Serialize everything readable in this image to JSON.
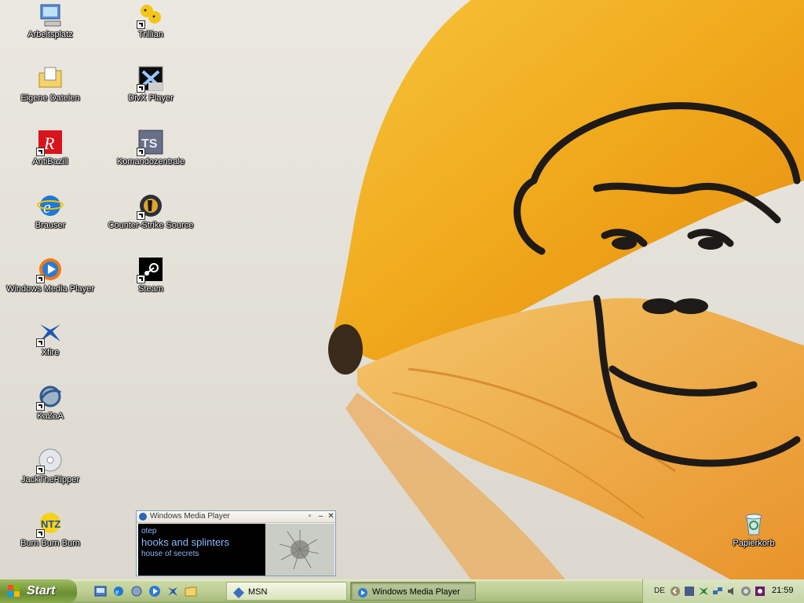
{
  "desktop": {
    "icons": [
      {
        "label": "Arbeitsplatz",
        "icon": "my-computer-icon"
      },
      {
        "label": "Eigene Dateien",
        "icon": "my-documents-icon"
      },
      {
        "label": "AntiBazill",
        "icon": "antivir-icon"
      },
      {
        "label": "Brauser",
        "icon": "internet-explorer-icon"
      },
      {
        "label": "Windows Media Player",
        "icon": "windows-media-player-icon"
      },
      {
        "label": "Xfire",
        "icon": "xfire-icon"
      },
      {
        "label": "KaZaA",
        "icon": "kazaa-icon"
      },
      {
        "label": "JackTheRipper",
        "icon": "cd-ripper-icon"
      },
      {
        "label": "Burn Burn Burn",
        "icon": "nero-burn-icon"
      },
      {
        "label": "Trillian",
        "icon": "trillian-icon"
      },
      {
        "label": "DivX Player",
        "icon": "divx-player-icon"
      },
      {
        "label": "Komandozentrale",
        "icon": "teamspeak-icon"
      },
      {
        "label": "Counter-Strike Source",
        "icon": "counter-strike-icon"
      },
      {
        "label": "Steam",
        "icon": "steam-icon"
      },
      {
        "label": "Papierkorb",
        "icon": "recycle-bin-icon"
      }
    ]
  },
  "mini_player": {
    "title": "Windows Media Player",
    "artist": "otep",
    "song": "hooks and splinters",
    "album": "house of secrets"
  },
  "taskbar": {
    "start_label": "Start",
    "quick_launch": [
      "show-desktop-icon",
      "internet-explorer-icon",
      "messenger-icon",
      "media-player-icon",
      "xfire-icon",
      "folder-icon"
    ],
    "tasks": [
      {
        "label": "MSN",
        "icon": "msn-icon"
      },
      {
        "label": "Windows Media Player",
        "icon": "windows-media-player-icon"
      }
    ],
    "tray": {
      "language": "DE",
      "clock": "21:59"
    }
  },
  "colors": {
    "taskbar": "#bfcf95",
    "start_button": "#7b9c3f",
    "wallpaper_bg": "#e9e6df",
    "banana": "#f0a81c"
  }
}
